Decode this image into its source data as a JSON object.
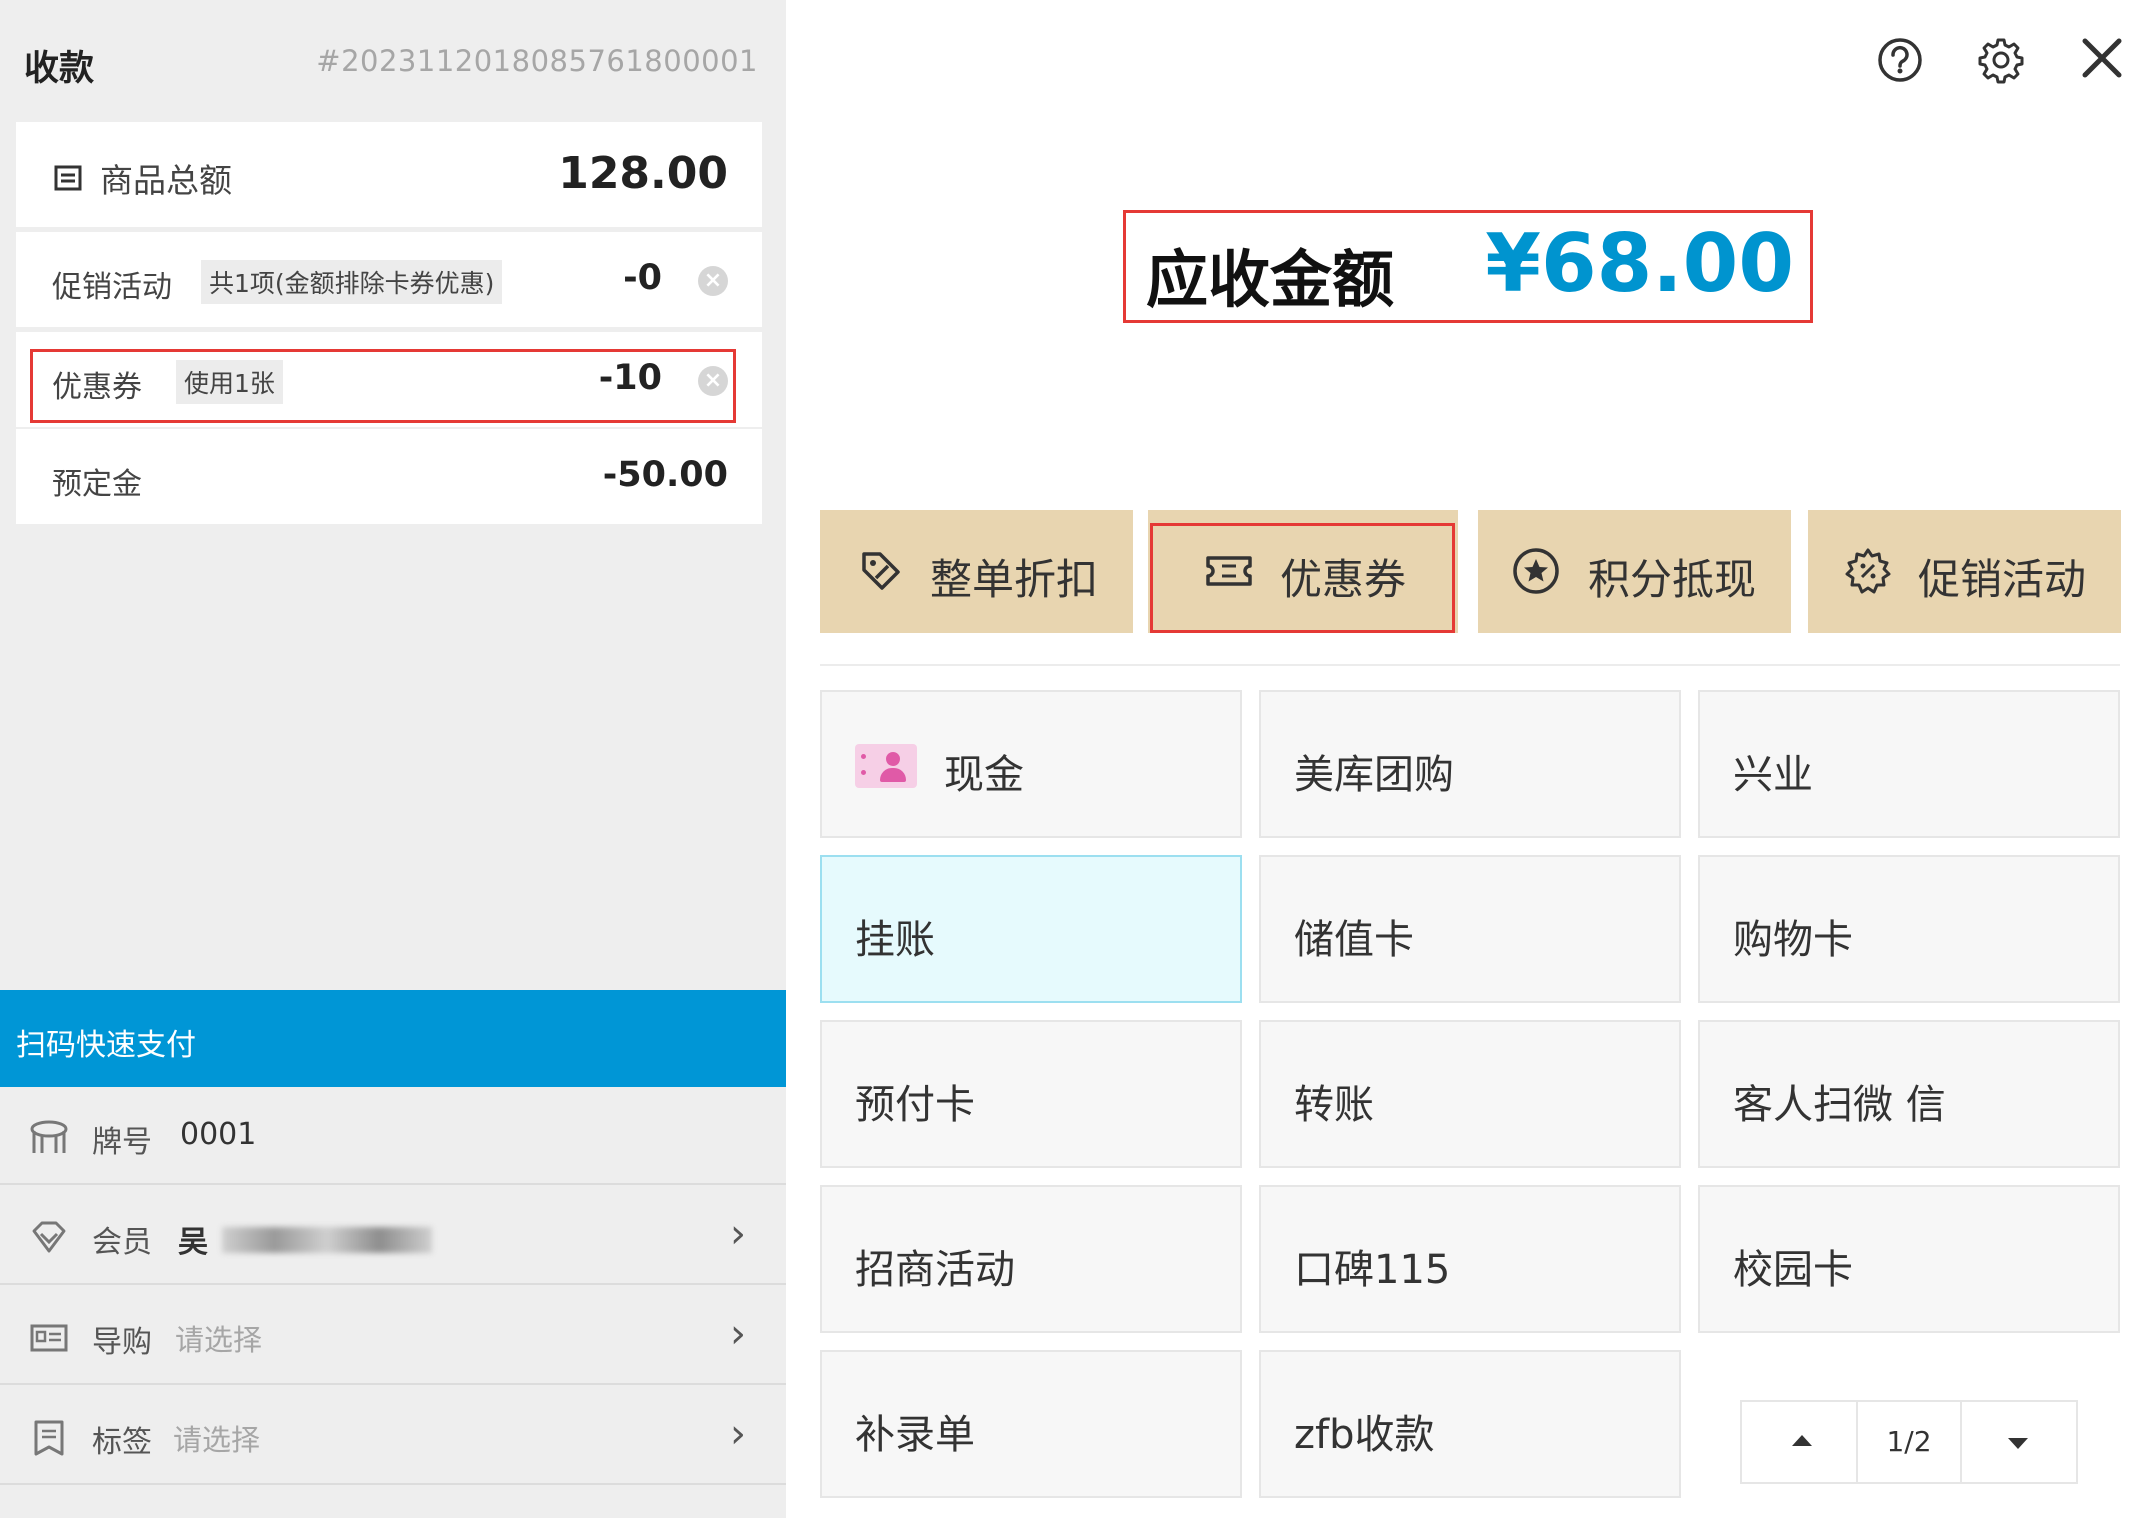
{
  "checkout": {
    "title": "收款",
    "order_no": "#2023112018085761800001",
    "items_total": {
      "label": "商品总额",
      "value": "128.00"
    },
    "promotion": {
      "label": "促销活动",
      "tag": "共1项(金额排除卡券优惠)",
      "value": "-0"
    },
    "coupon": {
      "label": "优惠券",
      "tag": "使用1张",
      "value": "-10"
    },
    "deposit": {
      "label": "预定金",
      "value": "-50.00"
    },
    "scan_pay": "扫码快速支付",
    "table": {
      "label": "牌号",
      "value": "0001"
    },
    "member": {
      "label": "会员",
      "value": "吴"
    },
    "guide": {
      "label": "导购",
      "placeholder": "请选择"
    },
    "tags": {
      "label": "标签",
      "placeholder": "请选择"
    }
  },
  "header_icons": [
    "help-icon",
    "settings-icon",
    "close-icon"
  ],
  "receivable": {
    "label": "应收金额",
    "amount": "¥68.00"
  },
  "discount_actions": [
    {
      "label": "整单折扣",
      "icon": "discount-tag-icon"
    },
    {
      "label": "优惠券",
      "icon": "ticket-icon"
    },
    {
      "label": "积分抵现",
      "icon": "star-circle-icon"
    },
    {
      "label": "促销活动",
      "icon": "promo-gear-icon"
    }
  ],
  "payment_methods": [
    {
      "label": "现金"
    },
    {
      "label": "美库团购"
    },
    {
      "label": "兴业"
    },
    {
      "label": "挂账"
    },
    {
      "label": "储值卡"
    },
    {
      "label": "购物卡"
    },
    {
      "label": "预付卡"
    },
    {
      "label": "转账"
    },
    {
      "label": "客人扫微 信"
    },
    {
      "label": "招商活动"
    },
    {
      "label": "口碑115"
    },
    {
      "label": "校园卡"
    },
    {
      "label": "补录单"
    },
    {
      "label": "zfb收款"
    }
  ],
  "pager": {
    "page": "1/2"
  },
  "colors": {
    "accent": "#0096d6",
    "amount": "#0094cf",
    "chip": "#e8d5b0",
    "highlight": "#e53935",
    "selected_tile": "#e6fafd"
  }
}
